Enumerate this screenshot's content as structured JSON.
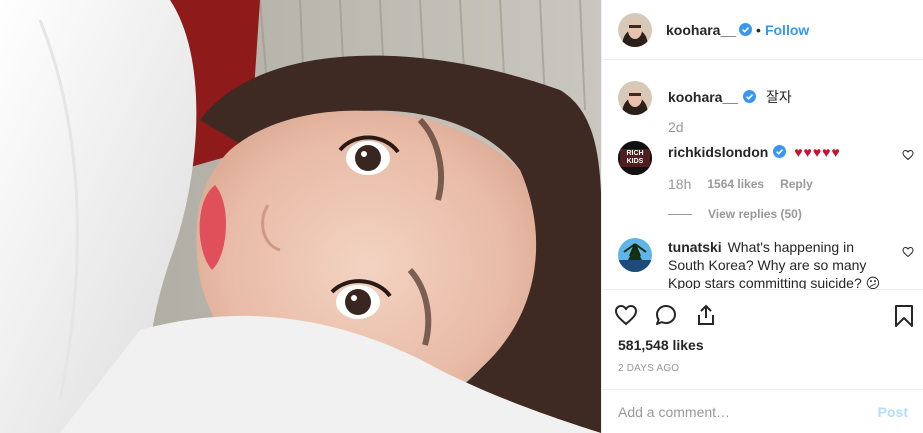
{
  "post": {
    "author": {
      "username": "koohara__",
      "verified": true
    },
    "header": {
      "separator": "•",
      "follow_label": "Follow"
    },
    "comments": [
      {
        "username": "koohara__",
        "verified": true,
        "text": "잘자",
        "time": "2d"
      },
      {
        "username": "richkidslondon",
        "verified": true,
        "text": "♥♥♥♥♥",
        "time": "18h",
        "likes": "1564 likes",
        "reply_label": "Reply",
        "view_replies": "View replies (50)",
        "avatar_text": "RICH KIDS"
      },
      {
        "username": "tunatski",
        "verified": false,
        "text": "What's happening in South Korea? Why are so many Kpop stars committing suicide? 😕"
      }
    ],
    "likes_count": "581,548 likes",
    "timestamp": "2 DAYS AGO",
    "add_comment": {
      "placeholder": "Add a comment…",
      "post_label": "Post"
    }
  },
  "colors": {
    "accent": "#3897f0",
    "heart_red": "#c4122f",
    "muted": "#999999",
    "border": "#efefef"
  },
  "icons": [
    "heart-icon",
    "comment-icon",
    "share-icon",
    "bookmark-icon",
    "verified-badge-icon"
  ]
}
